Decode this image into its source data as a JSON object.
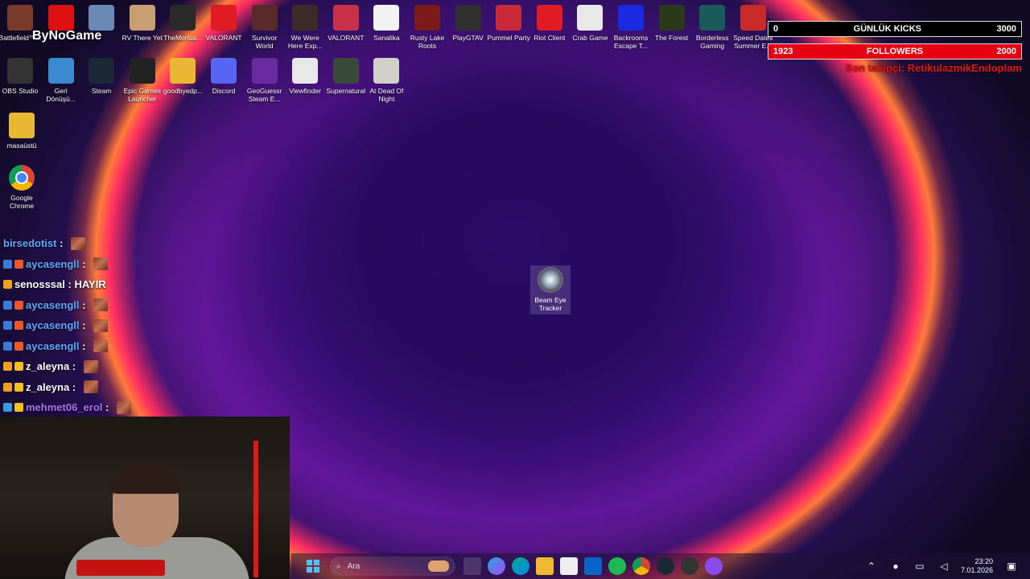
{
  "desktop": {
    "row1": [
      {
        "label": "Battlefield™...",
        "color": "#7a3b2a"
      },
      {
        "label": "",
        "color": "#d11"
      },
      {
        "label": "",
        "color": "#6a8ab5"
      },
      {
        "label": "RV There Yet",
        "color": "#c8a070"
      },
      {
        "label": "TheMortua...",
        "color": "#2a2a2a"
      },
      {
        "label": "VALORANT",
        "color": "#e01b24"
      },
      {
        "label": "Survivor World",
        "color": "#5a2a2a"
      },
      {
        "label": "We Were Here Exp...",
        "color": "#3d2a2a"
      },
      {
        "label": "VALORANT",
        "color": "#c8314a"
      },
      {
        "label": "Sanalika",
        "color": "#f2f2f2"
      },
      {
        "label": "Rusty Lake Roots",
        "color": "#7a1a1a"
      },
      {
        "label": "PlayGTAV",
        "color": "#303030"
      },
      {
        "label": "Pummel Party",
        "color": "#c82a3a"
      },
      {
        "label": "Riot Client",
        "color": "#e01b24"
      },
      {
        "label": "Crab Game",
        "color": "#e8e8e8"
      },
      {
        "label": "Backrooms Escape T...",
        "color": "#1a2ae0"
      },
      {
        "label": "The Forest",
        "color": "#2a3a1a"
      },
      {
        "label": "Borderless Gaming",
        "color": "#1a5a5a"
      },
      {
        "label": "Speed Dates Summer E...",
        "color": "#c82a2a"
      }
    ],
    "row2": [
      {
        "label": "OBS Studio",
        "color": "#333"
      },
      {
        "label": "Geri Dönüşü...",
        "color": "#3a8ad0"
      },
      {
        "label": "Steam",
        "color": "#1b2838"
      },
      {
        "label": "Epic Games Launcher",
        "color": "#222"
      },
      {
        "label": "goodbyedp...",
        "color": "#e8b832"
      },
      {
        "label": "Discord",
        "color": "#5865f2"
      },
      {
        "label": "GeoGuessr Steam E...",
        "color": "#6a2aa0"
      },
      {
        "label": "Viewfinder",
        "color": "#e8e8e8"
      },
      {
        "label": "Supernatural",
        "color": "#3a4a3a"
      },
      {
        "label": "At Dead Of Night",
        "color": "#d0d0c8"
      }
    ],
    "folder_label": "masaüstü",
    "chrome_label": "Google Chrome",
    "beam_label": "Beam Eye Tracker",
    "stream_logo": "ByNoGame"
  },
  "overlay": {
    "kicks_left": "0",
    "kicks_label": "GÜNLÜK KICKS",
    "kicks_right": "3000",
    "kicks_fill": 0,
    "followers_left": "1923",
    "followers_label": "FOLLOWERS",
    "followers_right": "2000",
    "followers_fill": 0.96,
    "last_follower": "Son takipçi: RetikulazmikEndoplam"
  },
  "chat": [
    {
      "user": "birsedotist",
      "text": "",
      "name_class": "uname-blue",
      "badges": [],
      "emote": true
    },
    {
      "user": "aycasengll",
      "text": "",
      "name_class": "uname-blue",
      "badges": [
        "#3a7bd5",
        "#e85a2a"
      ],
      "emote": true
    },
    {
      "user": "senosssal",
      "text": "HAYIR",
      "name_class": "uname-white",
      "badges": [
        "#f0a020"
      ],
      "emote": false
    },
    {
      "user": "aycasengll",
      "text": "",
      "name_class": "uname-blue",
      "badges": [
        "#3a7bd5",
        "#e85a2a"
      ],
      "emote": true
    },
    {
      "user": "aycasengll",
      "text": "",
      "name_class": "uname-blue",
      "badges": [
        "#3a7bd5",
        "#e85a2a"
      ],
      "emote": true
    },
    {
      "user": "aycasengll",
      "text": "",
      "name_class": "uname-blue",
      "badges": [
        "#3a7bd5",
        "#e85a2a"
      ],
      "emote": true
    },
    {
      "user": "z_aleyna",
      "text": "",
      "name_class": "uname-white",
      "badges": [
        "#f0a020",
        "#f0c020"
      ],
      "emote": true
    },
    {
      "user": "z_aleyna",
      "text": "",
      "name_class": "uname-white",
      "badges": [
        "#f0a020",
        "#f0c020"
      ],
      "emote": true
    },
    {
      "user": "mehmet06_erol",
      "text": "",
      "name_class": "uname-purple",
      "badges": [
        "#3a9ae0",
        "#f0c020"
      ],
      "emote": true
    }
  ],
  "taskbar": {
    "search_placeholder": "Ara",
    "time": "23:20",
    "date": "7.01.2026"
  }
}
